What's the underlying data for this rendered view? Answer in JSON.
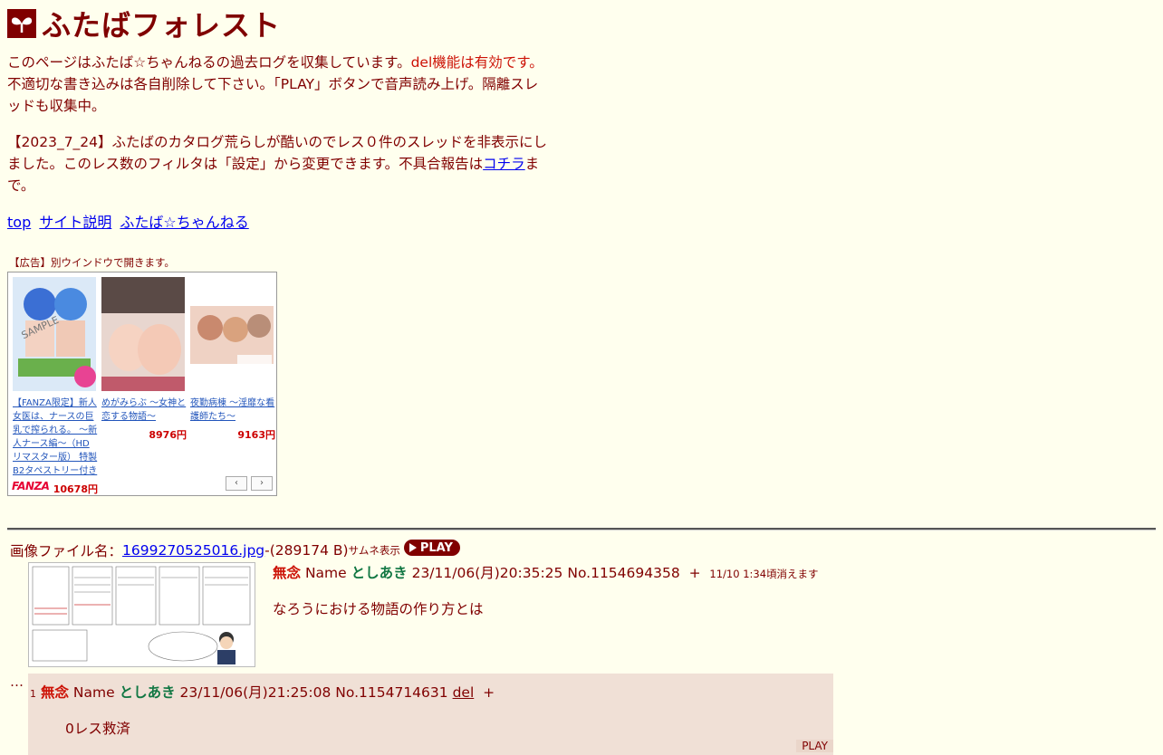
{
  "header": {
    "site_title": "ふたばフォレスト",
    "logo_icon": "sprout-icon"
  },
  "intro": {
    "p1_a": "このページはふたば☆ちゃんねるの過去ログを収集しています。",
    "p1_del": "del機能は有効です。",
    "p1_b": "不適切な書き込みは各自削除して下さい。「PLAY」ボタンで音声読み上げ。隔離スレッドも収集中。",
    "p2_a": "【2023_7_24】ふたばのカタログ荒らしが酷いのでレス０件のスレッドを非表示にしました。このレス数のフィルタは「設定」から変更できます。不具合報告は",
    "p2_link": "コチラ",
    "p2_b": "まで。"
  },
  "nav": {
    "top": "top",
    "about": "サイト説明",
    "futaba": "ふたば☆ちゃんねる"
  },
  "ad": {
    "note": "【広告】別ウインドウで開きます。",
    "items": [
      {
        "title": "【FANZA限定】新人女医は、ナースの巨乳で搾られる。 ～新人ナース編～（HDリマスター版） 特製B2タペストリー付き",
        "price": "10678円"
      },
      {
        "title": "めがみらぶ ～女神と恋する物語～",
        "price": "8976円"
      },
      {
        "title": "夜勤病棟 ～淫靡な看護師たち～",
        "price": "9163円"
      }
    ],
    "brand": "FANZA",
    "prev": "‹",
    "next": "›"
  },
  "thread": {
    "file_label": "画像ファイル名：",
    "file_name": "1699270525016.jpg",
    "file_size": "-(289174 B)",
    "thumb_label": "サムネ表示",
    "play": "PLAY",
    "op": {
      "subject": "無念",
      "name_label": "Name",
      "name": "としあき",
      "date": "23/11/06(月)20:35:25",
      "no": "No.1154694358",
      "plus": "+",
      "expire": "11/10 1:34頃消えます",
      "text": "なろうにおける物語の作り方とは"
    },
    "ellipsis": "…",
    "reply": {
      "num": "1",
      "subject": "無念",
      "name_label": "Name",
      "name": "としあき",
      "date": "23/11/06(月)21:25:08",
      "no": "No.1154714631",
      "del": "del",
      "plus": "+",
      "text": "0レス救済",
      "play": "PLAY"
    }
  }
}
